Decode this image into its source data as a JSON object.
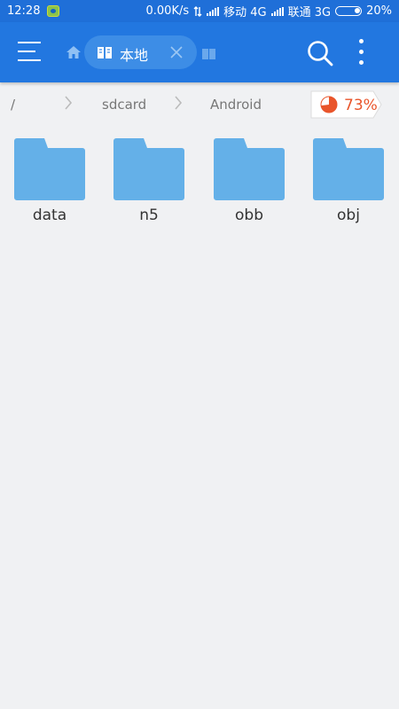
{
  "status_bar": {
    "time": "12:28",
    "speed": "0.00K/s",
    "carrier1": "移动 4G",
    "carrier2": "联通 3G",
    "battery": "20%"
  },
  "toolbar": {
    "tab_label": "本地",
    "icons": [
      "menu-icon",
      "home-icon",
      "book-icon",
      "close-icon",
      "search-icon",
      "more-vert-icon"
    ]
  },
  "path": {
    "crumbs": [
      "/",
      "sdcard",
      "Android"
    ],
    "storage_percent": "73%",
    "storage_used_fraction": 0.73
  },
  "folders": [
    {
      "name": "data"
    },
    {
      "name": "n5"
    },
    {
      "name": "obb"
    },
    {
      "name": "obj"
    }
  ],
  "colors": {
    "status_bar": "#1f6fd8",
    "toolbar": "#2277e0",
    "folder": "#64b0e8",
    "storage": "#e9552b"
  }
}
